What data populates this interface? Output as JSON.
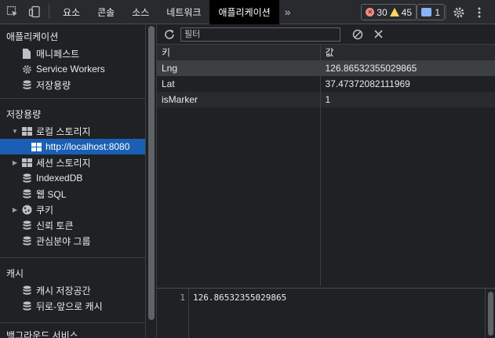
{
  "toolbar": {
    "tabs": [
      {
        "label": "요소"
      },
      {
        "label": "콘솔"
      },
      {
        "label": "소스"
      },
      {
        "label": "네트워크"
      },
      {
        "label": "애플리케이션"
      }
    ],
    "more_label": "»",
    "error_count": "30",
    "warning_count": "45",
    "message_count": "1"
  },
  "sidebar": {
    "sections": [
      {
        "title": "애플리케이션",
        "items": [
          {
            "label": "매니페스트",
            "icon": "document-icon"
          },
          {
            "label": "Service Workers",
            "icon": "gear-icon"
          },
          {
            "label": "저장용량",
            "icon": "database-icon"
          }
        ]
      },
      {
        "title": "저장용량",
        "items": [
          {
            "label": "로컬 스토리지",
            "icon": "grid-icon"
          },
          {
            "label": "http://localhost:8080",
            "icon": "grid-icon"
          },
          {
            "label": "세션 스토리지",
            "icon": "grid-icon"
          },
          {
            "label": "IndexedDB",
            "icon": "database-icon"
          },
          {
            "label": "웹 SQL",
            "icon": "database-icon"
          },
          {
            "label": "쿠키",
            "icon": "cookie-icon"
          },
          {
            "label": "신뢰 토큰",
            "icon": "database-icon"
          },
          {
            "label": "관심분야 그룹",
            "icon": "database-icon"
          }
        ]
      },
      {
        "title": "캐시",
        "items": [
          {
            "label": "캐시 저장공간",
            "icon": "database-icon"
          },
          {
            "label": "뒤로-앞으로 캐시",
            "icon": "database-icon"
          }
        ]
      },
      {
        "title": "백그라운드 서비스"
      }
    ]
  },
  "main": {
    "filter_placeholder": "필터",
    "table": {
      "headers": [
        "키",
        "값"
      ],
      "rows": [
        {
          "key": "Lng",
          "value": "126.86532355029865"
        },
        {
          "key": "Lat",
          "value": "37.47372082111969"
        },
        {
          "key": "isMarker",
          "value": "1"
        }
      ]
    },
    "preview": {
      "line_number": "1",
      "text": "126.86532355029865"
    }
  },
  "colors": {
    "accent": "#1a5fb4",
    "background": "#202124",
    "error": "#f28b82",
    "warning": "#fdd663",
    "info": "#8ab4f8"
  }
}
